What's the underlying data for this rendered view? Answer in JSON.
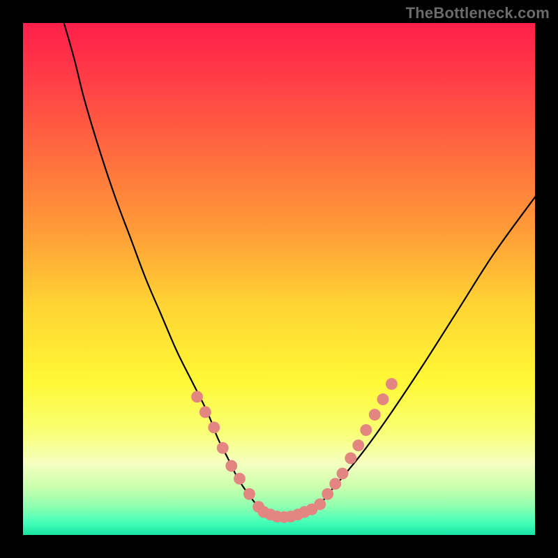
{
  "watermark": "TheBottleneck.com",
  "colors": {
    "black": "#000000",
    "curve": "#000000",
    "marker": "#e38580",
    "gradient_stops": [
      {
        "offset": 0.0,
        "color": "#ff1f4a"
      },
      {
        "offset": 0.1,
        "color": "#ff3a47"
      },
      {
        "offset": 0.25,
        "color": "#ff6a3f"
      },
      {
        "offset": 0.4,
        "color": "#ff9a38"
      },
      {
        "offset": 0.55,
        "color": "#ffd433"
      },
      {
        "offset": 0.7,
        "color": "#fff835"
      },
      {
        "offset": 0.8,
        "color": "#f9ff76"
      },
      {
        "offset": 0.86,
        "color": "#f5ffc0"
      },
      {
        "offset": 0.905,
        "color": "#ccffad"
      },
      {
        "offset": 0.945,
        "color": "#8dffb0"
      },
      {
        "offset": 0.975,
        "color": "#45ffb9"
      },
      {
        "offset": 1.0,
        "color": "#17e3a2"
      }
    ]
  },
  "chart_data": {
    "type": "line",
    "title": "",
    "xlabel": "",
    "ylabel": "",
    "xlim": [
      0,
      100
    ],
    "ylim": [
      0,
      100
    ],
    "grid": false,
    "legend": false,
    "series": [
      {
        "name": "bottleneck-curve",
        "x": [
          8,
          10,
          12,
          15,
          18,
          21,
          24,
          27,
          30,
          33,
          36,
          38,
          40,
          42,
          44,
          46,
          48,
          50,
          52,
          54,
          56,
          58,
          60,
          63,
          67,
          72,
          78,
          85,
          92,
          100
        ],
        "y": [
          100,
          93,
          85,
          75,
          66,
          58,
          50,
          43,
          36,
          30,
          24,
          19,
          15,
          11,
          8,
          5.5,
          4,
          3,
          3,
          3.5,
          4.5,
          6,
          8.5,
          12,
          17,
          24,
          33,
          44,
          55,
          66
        ]
      }
    ],
    "markers": [
      {
        "x": 34.0,
        "y": 27.0
      },
      {
        "x": 35.6,
        "y": 24.0
      },
      {
        "x": 37.3,
        "y": 21.0
      },
      {
        "x": 39.0,
        "y": 17.0
      },
      {
        "x": 40.7,
        "y": 13.5
      },
      {
        "x": 42.3,
        "y": 11.0
      },
      {
        "x": 44.2,
        "y": 8.0
      },
      {
        "x": 46.0,
        "y": 5.5
      },
      {
        "x": 47.0,
        "y": 4.5
      },
      {
        "x": 48.3,
        "y": 4.0
      },
      {
        "x": 49.6,
        "y": 3.6
      },
      {
        "x": 51.0,
        "y": 3.5
      },
      {
        "x": 52.3,
        "y": 3.6
      },
      {
        "x": 53.7,
        "y": 4.0
      },
      {
        "x": 55.0,
        "y": 4.5
      },
      {
        "x": 56.4,
        "y": 5.0
      },
      {
        "x": 58.0,
        "y": 6.0
      },
      {
        "x": 59.5,
        "y": 8.0
      },
      {
        "x": 61.0,
        "y": 10.0
      },
      {
        "x": 62.4,
        "y": 12.0
      },
      {
        "x": 64.0,
        "y": 15.0
      },
      {
        "x": 65.5,
        "y": 17.5
      },
      {
        "x": 67.0,
        "y": 20.5
      },
      {
        "x": 68.7,
        "y": 23.5
      },
      {
        "x": 70.3,
        "y": 26.5
      },
      {
        "x": 72.0,
        "y": 29.5
      }
    ],
    "marker_radius_pct": 1.15
  }
}
